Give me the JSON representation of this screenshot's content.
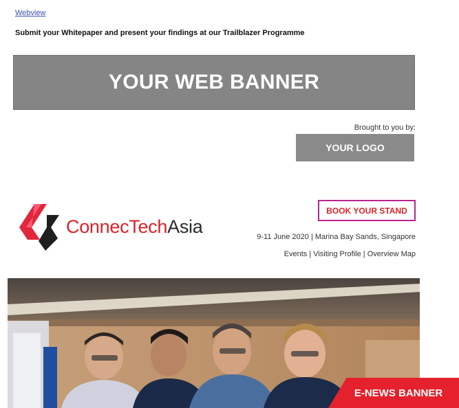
{
  "email": {
    "webview_label": "Webview",
    "subject": "Submit your Whitepaper and present your findings at our Trailblazer Programme"
  },
  "web_banner": {
    "label": "YOUR WEB BANNER"
  },
  "sponsor": {
    "brought_to_you_by": "Brought to you by:",
    "logo_label": "YOUR LOGO"
  },
  "event": {
    "brand_first": "ConnecTech",
    "brand_second": "Asia",
    "cta_label": "BOOK YOUR STAND",
    "details": "9-11 June 2020 | Marina Bay Sands, Singapore",
    "links": [
      "Events",
      "Visiting Profile",
      "Overview Map"
    ],
    "links_text": "Events | Visiting Profile | Overview Map"
  },
  "corner_tag": {
    "label": "E-NEWS BANNER"
  },
  "colors": {
    "brand_red": "#d8232a",
    "banner_gray": "#858585",
    "cta_border": "#b7258f",
    "tag_red": "#e4212c"
  },
  "icons": {
    "brand_logo": "connectech-asia-logo-icon"
  }
}
